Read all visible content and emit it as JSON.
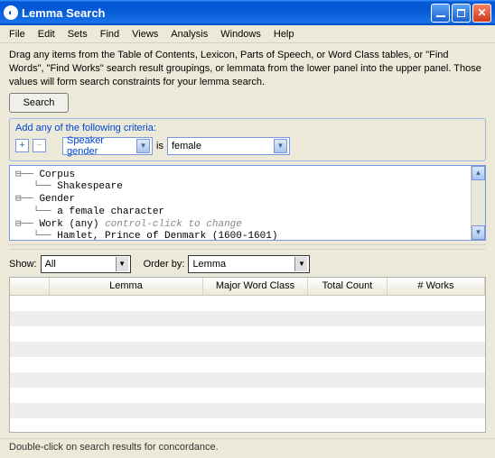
{
  "window": {
    "title": "Lemma Search"
  },
  "menu": [
    "File",
    "Edit",
    "Sets",
    "Find",
    "Views",
    "Analysis",
    "Windows",
    "Help"
  ],
  "instructions": "Drag any items from the Table of Contents, Lexicon, Parts of Speech, or Word Class tables, or \"Find Words\", \"Find Works\" search result groupings, or lemmata from the lower panel into the upper panel. Those values will form search constraints for your lemma search.",
  "search_button": "Search",
  "criteria": {
    "header": "Add any of the following criteria:",
    "plus": "+",
    "minus": "−",
    "field": "Speaker gender",
    "operator": "is",
    "value": "female"
  },
  "tree": {
    "nodes": [
      {
        "expander": "⊟",
        "indent": 0,
        "label": "Corpus",
        "hint": ""
      },
      {
        "expander": "",
        "indent": 1,
        "label": "Shakespeare",
        "hint": ""
      },
      {
        "expander": "⊟",
        "indent": 0,
        "label": "Gender",
        "hint": ""
      },
      {
        "expander": "",
        "indent": 1,
        "label": "a female character",
        "hint": ""
      },
      {
        "expander": "⊟",
        "indent": 0,
        "label": "Work (any)",
        "hint": "control-click to change"
      },
      {
        "expander": "",
        "indent": 1,
        "label": "Hamlet, Prince of Denmark (1600-1601)",
        "hint": ""
      }
    ]
  },
  "filters": {
    "show_label": "Show:",
    "show_value": "All",
    "order_label": "Order by:",
    "order_value": "Lemma"
  },
  "columns": [
    "",
    "Lemma",
    "Major Word Class",
    "Total Count",
    "# Works"
  ],
  "status": "Double-click on search results for concordance."
}
